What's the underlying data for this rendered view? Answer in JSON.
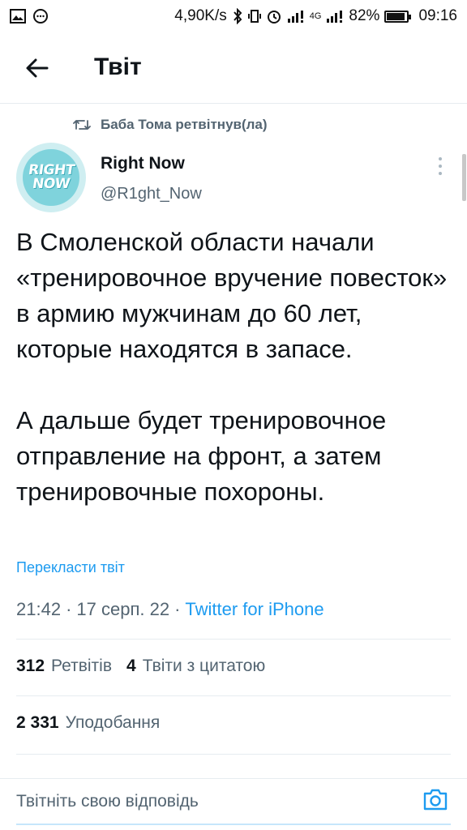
{
  "status_bar": {
    "speed": "4,90K/s",
    "network": "4G",
    "battery_pct": "82%",
    "battery_level": 0.82,
    "time": "09:16"
  },
  "header": {
    "title": "Твіт",
    "back_icon": "arrow-left-icon"
  },
  "retweet": {
    "icon": "retweet-icon",
    "text": "Баба Тома ретвітнув(ла)"
  },
  "author": {
    "avatar_line1": "RIGHT",
    "avatar_line2": "NOW",
    "name": "Right Now",
    "handle": "@R1ght_Now",
    "more_icon": "more-vertical-icon"
  },
  "tweet": {
    "paragraph1": "В Смоленской области начали «тренировочное вручение повесток» в армию мужчинам до 60 лет, которые находятся в запасе.",
    "paragraph2": "А дальше будет тренировочное отправление на фронт, а затем тренировочные похороны.",
    "translate": "Перекласти твіт",
    "time": "21:42",
    "date": "17 серп. 22",
    "separator": "·",
    "source": "Twitter for iPhone"
  },
  "stats": {
    "retweets_count": "312",
    "retweets_label": "Ретвітів",
    "quotes_count": "4",
    "quotes_label": "Твіти з цитатою",
    "likes_count": "2 331",
    "likes_label": "Уподобання"
  },
  "reply": {
    "placeholder": "Твітніть свою відповідь",
    "camera_icon": "camera-icon"
  },
  "colors": {
    "accent": "#1d9bf0",
    "secondary_text": "#536471",
    "avatar_bg": "#7fd3dc"
  }
}
